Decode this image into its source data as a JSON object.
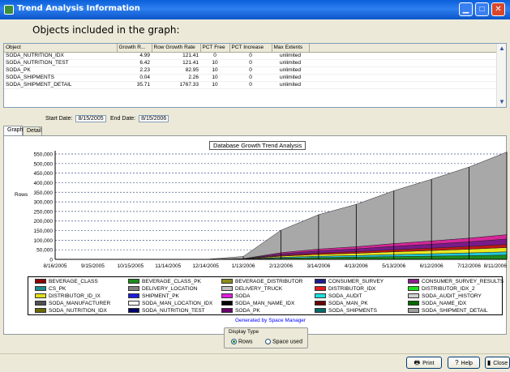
{
  "window": {
    "title": "Trend Analysis Information",
    "minimize_icon": "minimize-icon",
    "maximize_icon": "maximize-icon",
    "close_icon": "close-icon"
  },
  "header": {
    "objects_label": "Objects included in the graph:"
  },
  "grid": {
    "columns": [
      "Object",
      "Growth R...",
      "Row Growth Rate",
      "PCT Free",
      "PCT Increase",
      "Max Extents"
    ],
    "rows": [
      [
        "SODA_NUTRITION_IDX",
        "4.99",
        "121.41",
        "0",
        "0",
        "unlimited"
      ],
      [
        "SODA_NUTRITION_TEST",
        "6.42",
        "121.41",
        "10",
        "0",
        "unlimited"
      ],
      [
        "SODA_PK",
        "2.23",
        "82.95",
        "10",
        "0",
        "unlimited"
      ],
      [
        "SODA_SHIPMENTS",
        "0.04",
        "2.26",
        "10",
        "0",
        "unlimited"
      ],
      [
        "SODA_SHIPMENT_DETAIL",
        "35.71",
        "1767.33",
        "10",
        "0",
        "unlimited"
      ]
    ]
  },
  "dates": {
    "start_label": "Start Date:",
    "start_value": "8/15/2005",
    "end_label": "End Date:",
    "end_value": "8/15/2006"
  },
  "tabs": [
    "Graph",
    "Detail"
  ],
  "chart_data": {
    "type": "area",
    "title": "Database Growth Trend Analysis",
    "ylabel": "Rows",
    "xlabel": "",
    "ylim": [
      0,
      550000
    ],
    "yticks": [
      "550,000",
      "500,000",
      "450,000",
      "400,000",
      "350,000",
      "300,000",
      "250,000",
      "200,000",
      "150,000",
      "100,000",
      "50,000",
      "0"
    ],
    "x": [
      "8/16/2005",
      "9/15/2005",
      "10/15/2005",
      "11/14/2005",
      "12/14/2005",
      "1/13/2006",
      "2/12/2006",
      "3/14/2006",
      "4/13/2006",
      "5/13/2006",
      "6/12/2006",
      "7/12/2006",
      "8/11/2006"
    ],
    "stack_totals": [
      0,
      0,
      0,
      0,
      0,
      15000,
      152000,
      233000,
      287000,
      358000,
      418000,
      482000,
      560000
    ],
    "layers": [
      {
        "name": "SODA_SHIPMENT_DETAIL",
        "color": "#a8a8a8",
        "fraction": 0.77
      },
      {
        "name": "SODA_NAME_IDX",
        "color": "#d6269a",
        "fraction": 0.04
      },
      {
        "name": "CONSUMER_SURVEY_RESULTS",
        "color": "#7a1a8a",
        "fraction": 0.05
      },
      {
        "name": "DISTRIBUTOR_IDX",
        "color": "#c01818",
        "fraction": 0.03
      },
      {
        "name": "DISTRIBUTOR_ID_IX",
        "color": "#e8e820",
        "fraction": 0.04
      },
      {
        "name": "SODA_AUDIT",
        "color": "#20c8d8",
        "fraction": 0.03
      },
      {
        "name": "BEVERAGE_CLASS_PK",
        "color": "#1c8c1c",
        "fraction": 0.04
      }
    ],
    "grid": true,
    "legend_placement": "bottom"
  },
  "legend": [
    {
      "name": "BEVERAGE_CLASS",
      "color": "#8b0000"
    },
    {
      "name": "BEVERAGE_CLASS_PK",
      "color": "#1c8c1c"
    },
    {
      "name": "BEVERAGE_DISTRIBUTOR",
      "color": "#8c8c1c"
    },
    {
      "name": "CONSUMER_SURVEY",
      "color": "#1c1c8c"
    },
    {
      "name": "CONSUMER_SURVEY_RESULTS",
      "color": "#8c1c8c"
    },
    {
      "name": "CS_PK",
      "color": "#1c8c8c"
    },
    {
      "name": "DELIVERY_LOCATION",
      "color": "#808080"
    },
    {
      "name": "DELIVERY_TRUCK",
      "color": "#c0c0c0"
    },
    {
      "name": "DISTRIBUTOR_IDX",
      "color": "#e01c1c"
    },
    {
      "name": "DISTRIBUTOR_IDX_2",
      "color": "#1ce01c"
    },
    {
      "name": "DISTRIBUTOR_ID_IX",
      "color": "#e0e01c"
    },
    {
      "name": "SHIPMENT_PK",
      "color": "#1c1ce0"
    },
    {
      "name": "SODA",
      "color": "#e01ce0"
    },
    {
      "name": "SODA_AUDIT",
      "color": "#1ce0e0"
    },
    {
      "name": "SODA_AUDIT_HISTORY",
      "color": "#d0d0d0"
    },
    {
      "name": "SODA_MANUFACTURER",
      "color": "#505050"
    },
    {
      "name": "SODA_MAN_LOCATION_IDX",
      "color": "#ffffff"
    },
    {
      "name": "SODA_MAN_NAME_IDX",
      "color": "#000000"
    },
    {
      "name": "SODA_MAN_PK",
      "color": "#6a0000"
    },
    {
      "name": "SODA_NAME_IDX",
      "color": "#006a00"
    },
    {
      "name": "SODA_NUTRITION_IDX",
      "color": "#6a6a00"
    },
    {
      "name": "SODA_NUTRITION_TEST",
      "color": "#00006a"
    },
    {
      "name": "SODA_PK",
      "color": "#6a006a"
    },
    {
      "name": "SODA_SHIPMENTS",
      "color": "#006a6a"
    },
    {
      "name": "SODA_SHIPMENT_DETAIL",
      "color": "#a0a0a0"
    }
  ],
  "generated_by": "Generated by Space Manager",
  "display_type": {
    "label": "Display Type",
    "options": [
      "Rows",
      "Space used"
    ],
    "selected": "Rows"
  },
  "buttons": {
    "print": "Print",
    "help": "Help",
    "close": "Close"
  }
}
